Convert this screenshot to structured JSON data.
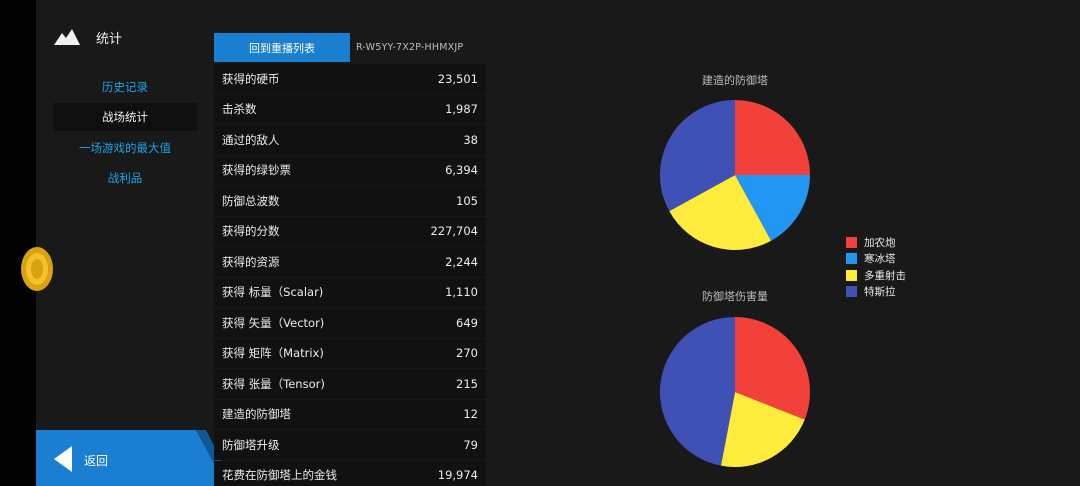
{
  "sidebar": {
    "title": "统计",
    "items": [
      {
        "label": "历史记录",
        "active": false
      },
      {
        "label": "战场统计",
        "active": true
      },
      {
        "label": "一场游戏的最大值",
        "active": false
      },
      {
        "label": "战利品",
        "active": false
      }
    ],
    "back_label": "返回"
  },
  "table": {
    "replay_button": "回到重播列表",
    "replay_code": "R-W5YY-7X2P-HHMXJP",
    "rows": [
      {
        "label": "获得的硬币",
        "value": "23,501"
      },
      {
        "label": "击杀数",
        "value": "1,987"
      },
      {
        "label": "通过的敌人",
        "value": "38"
      },
      {
        "label": "获得的绿钞票",
        "value": "6,394"
      },
      {
        "label": "防御总波数",
        "value": "105"
      },
      {
        "label": "获得的分数",
        "value": "227,704"
      },
      {
        "label": "获得的资源",
        "value": "2,244"
      },
      {
        "label": "获得 标量（Scalar)",
        "value": "1,110"
      },
      {
        "label": "获得 矢量（Vector)",
        "value": "649"
      },
      {
        "label": "获得 矩阵（Matrix)",
        "value": "270"
      },
      {
        "label": "获得 张量（Tensor)",
        "value": "215"
      },
      {
        "label": "建造的防御塔",
        "value": "12"
      },
      {
        "label": "防御塔升级",
        "value": "79"
      },
      {
        "label": "花费在防御塔上的金钱",
        "value": "19,974"
      }
    ]
  },
  "legend": [
    {
      "name": "加农炮",
      "color": "#f2403a"
    },
    {
      "name": "寒冰塔",
      "color": "#2196f3"
    },
    {
      "name": "多重射击",
      "color": "#ffeb3b"
    },
    {
      "name": "特斯拉",
      "color": "#3f51b5"
    }
  ],
  "chart_data": [
    {
      "type": "pie",
      "title": "建造的防御塔",
      "categories": [
        "加农炮",
        "寒冰塔",
        "多重射击",
        "特斯拉"
      ],
      "values": [
        25,
        17,
        25,
        33
      ]
    },
    {
      "type": "pie",
      "title": "防御塔伤害量",
      "categories": [
        "加农炮",
        "寒冰塔",
        "多重射击",
        "特斯拉"
      ],
      "values": [
        31,
        0,
        22,
        47
      ]
    }
  ]
}
